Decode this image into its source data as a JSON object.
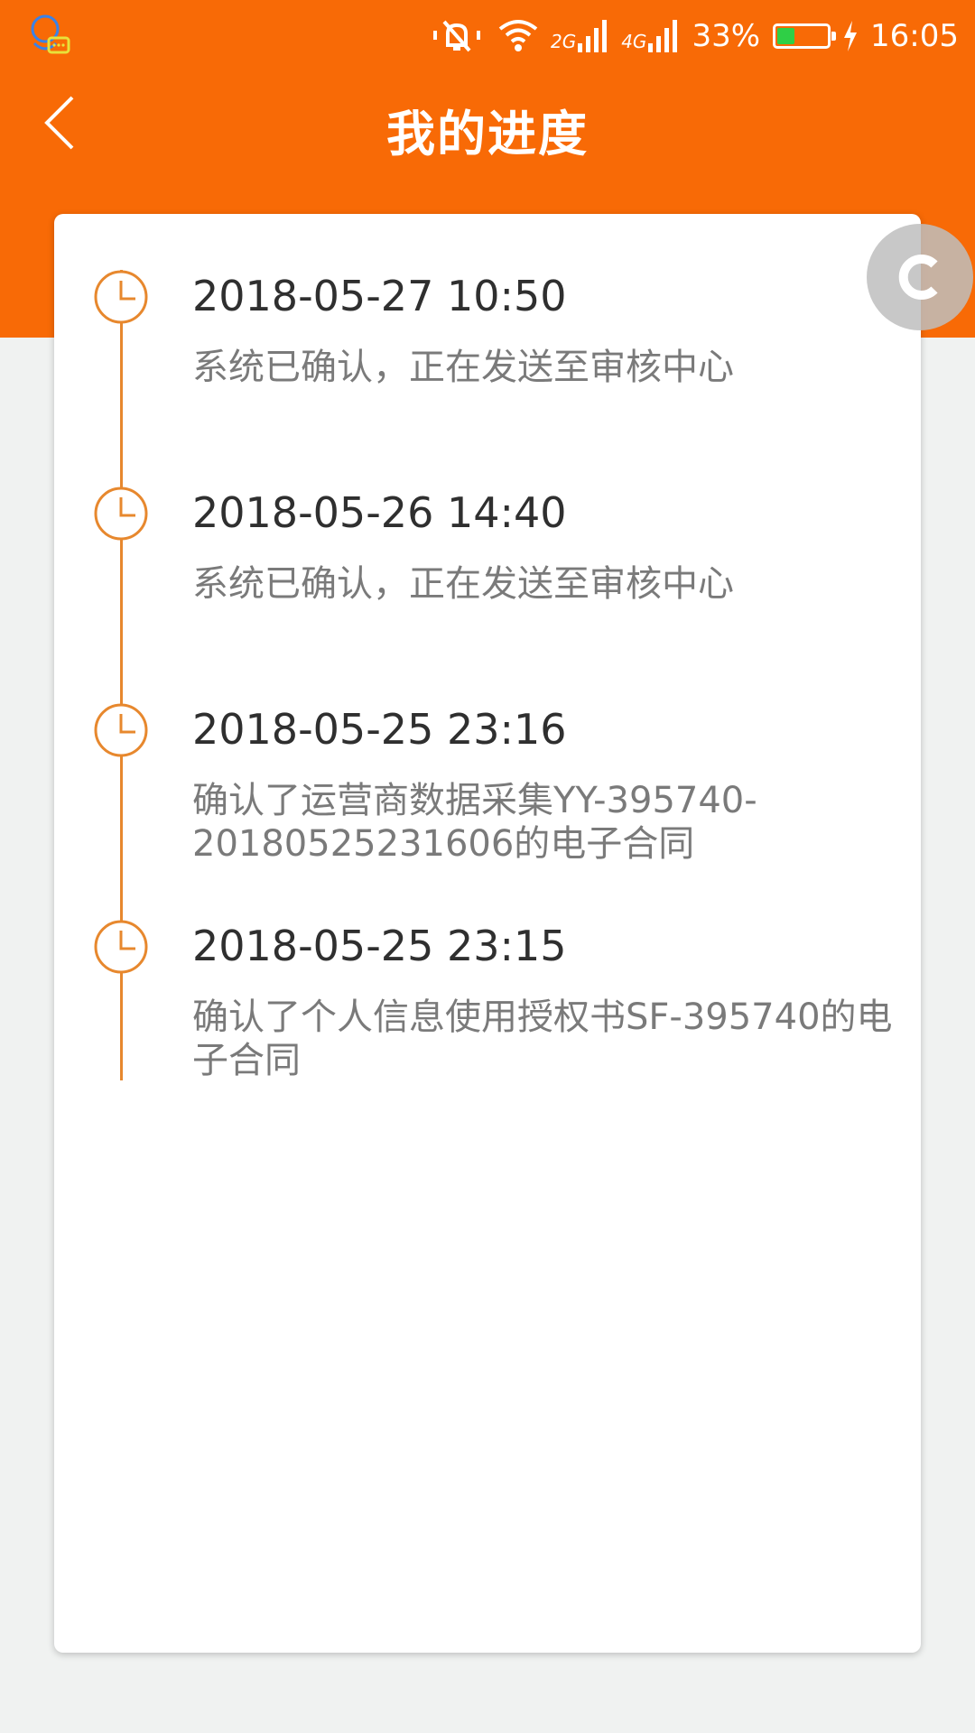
{
  "status_bar": {
    "time": "16:05",
    "battery_percent": "33%",
    "battery_level": 0.33,
    "network_1": "2G",
    "network_2": "4G",
    "icons": [
      "assistant-icon",
      "mute-icon",
      "wifi-icon",
      "signal-icon",
      "battery-icon",
      "charging-icon"
    ]
  },
  "title_bar": {
    "title": "我的进度",
    "back_icon": "chevron-left-icon"
  },
  "timeline": [
    {
      "time": "2018-05-27 10:50",
      "description": "系统已确认，正在发送至审核中心"
    },
    {
      "time": "2018-05-26 14:40",
      "description": "系统已确认，正在发送至审核中心"
    },
    {
      "time": "2018-05-25 23:16",
      "description": "确认了运营商数据采集YY-395740-20180525231606的电子合同"
    },
    {
      "time": "2018-05-25 23:15",
      "description": "确认了个人信息使用授权书SF-395740的电子合同"
    }
  ],
  "colors": {
    "header": "#f86a06",
    "timeline_accent": "#e7882e",
    "background": "#f0f2f1",
    "card": "#ffffff"
  },
  "floating_button_icon": "refresh-icon"
}
